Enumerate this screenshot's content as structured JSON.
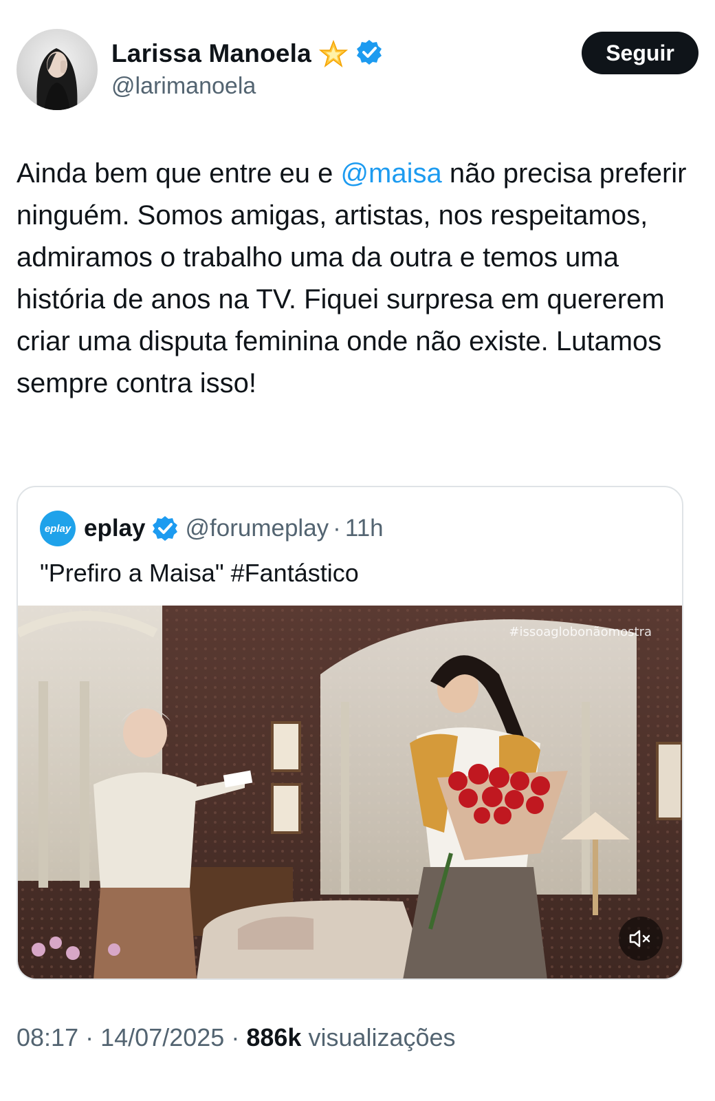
{
  "author": {
    "display_name": "Larissa Manoela",
    "handle": "@larimanoela",
    "follow_label": "Seguir",
    "verified_color": "#1d9bf0",
    "badge_icon": "glowing-star-icon"
  },
  "tweet": {
    "text_before": "Ainda bem que entre eu e ",
    "mention": "@maisa",
    "text_after": " não precisa preferir ninguém. Somos amigas, artistas, nos respeitamos, admiramos o trabalho uma da outra e temos uma história de anos na TV. Fiquei surpresa em quererem criar uma disputa feminina onde não existe. Lutamos sempre contra isso!"
  },
  "quoted": {
    "avatar_text": "eplay",
    "display_name": "eplay",
    "handle": "@forumeplay",
    "separator": "·",
    "time": "11h",
    "text": "\"Prefiro a Maisa\" #Fantástico",
    "media_watermark": "#issoaglobonãomostra",
    "mute_icon": "speaker-muted-icon"
  },
  "footer": {
    "time": "08:17",
    "separator": "·",
    "date": "14/07/2025",
    "views_count": "886k",
    "views_label": "visualizações"
  }
}
